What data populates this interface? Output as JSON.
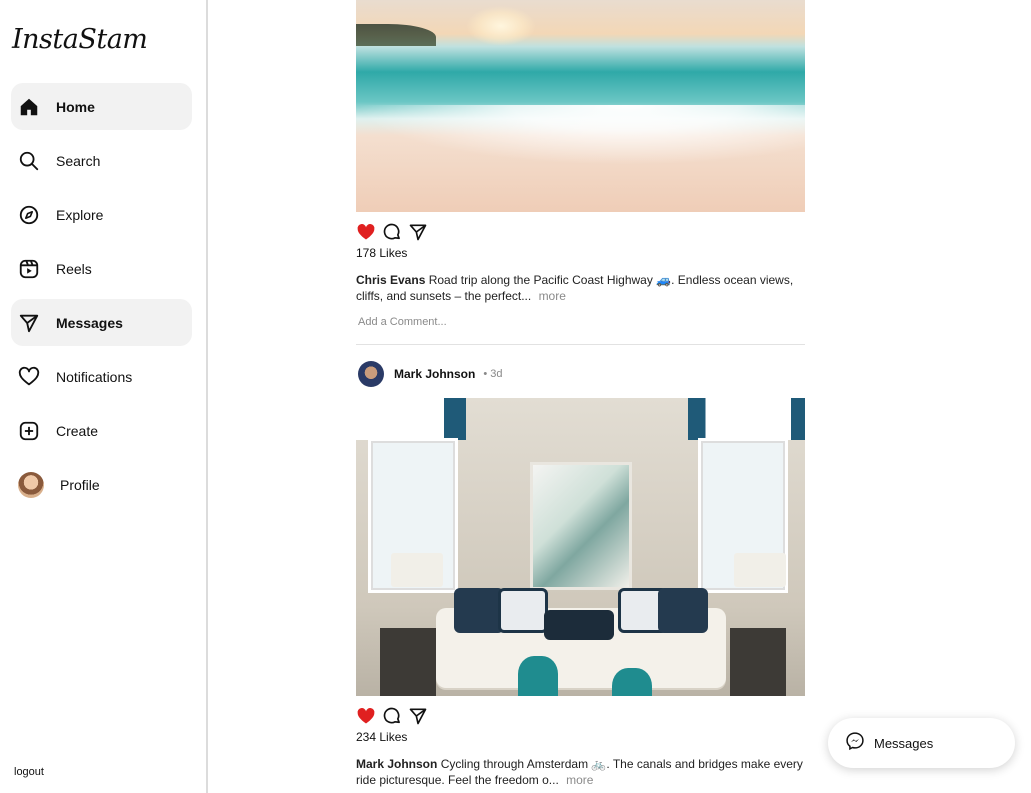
{
  "app": {
    "logo": "InstaStam"
  },
  "sidebar": {
    "items": [
      {
        "label": "Home",
        "icon": "home-icon",
        "active": true
      },
      {
        "label": "Search",
        "icon": "search-icon",
        "active": false
      },
      {
        "label": "Explore",
        "icon": "compass-icon",
        "active": false
      },
      {
        "label": "Reels",
        "icon": "reels-icon",
        "active": false
      },
      {
        "label": "Messages",
        "icon": "send-icon",
        "active": true
      },
      {
        "label": "Notifications",
        "icon": "heart-icon",
        "active": false
      },
      {
        "label": "Create",
        "icon": "plus-square-icon",
        "active": false
      },
      {
        "label": "Profile",
        "icon": "avatar",
        "active": false
      }
    ],
    "logout": "logout"
  },
  "feed": {
    "posts": [
      {
        "image_alt": "beach at sunset",
        "likes": "178 Likes",
        "caption_user": "Chris Evans",
        "caption_text": "Road trip along the Pacific Coast Highway 🚙. Endless ocean views, cliffs, and sunsets – the perfect...",
        "more": "more",
        "comment_placeholder": "Add a Comment..."
      },
      {
        "user": "Mark Johnson",
        "time": "• 3d",
        "image_alt": "living room interior",
        "likes": "234 Likes",
        "caption_user": "Mark Johnson",
        "caption_text": "Cycling through Amsterdam 🚲. The canals and bridges make every ride picturesque. Feel the freedom o...",
        "more": "more"
      }
    ]
  },
  "messages_button": {
    "label": "Messages",
    "icon": "messenger-icon"
  },
  "colors": {
    "like_red": "#e02020",
    "active_bg": "#f2f2f2",
    "divider": "#dcdcdc"
  }
}
